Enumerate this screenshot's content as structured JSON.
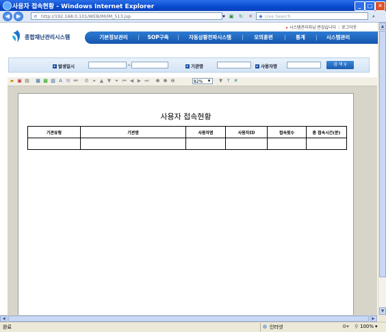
{
  "window": {
    "title": "사용자 접속현황 - Windows Internet Explorer"
  },
  "browser": {
    "url": "http://192.168.0.101/WEB/IM/IM_513.jsp",
    "search_placeholder": "Live Search"
  },
  "site": {
    "utility_links": [
      "시스템관리자님 반갑습니다",
      "로그아웃"
    ],
    "logo_text": "종합재난관리시스템",
    "nav": [
      "기본정보관리",
      "SOP구축",
      "자동상황전파시스템",
      "모의훈련",
      "통계",
      "시스템관리"
    ]
  },
  "search": {
    "labels": {
      "date": "발생일시",
      "agency": "기관명",
      "user": "사용자명"
    },
    "date_separator": "~",
    "button_label": "검 색"
  },
  "report_toolbar": {
    "zoom": "82%"
  },
  "report": {
    "title": "사용자 접속현황",
    "columns": [
      "기관유형",
      "기관명",
      "사용자명",
      "사용자ID",
      "접속횟수",
      "총 접속시간(분)"
    ],
    "rows": [
      [
        "",
        "",
        "",
        "",
        "",
        ""
      ]
    ]
  },
  "status": {
    "left": "완료",
    "zone": "인터넷",
    "zoom": "100%"
  },
  "colors": {
    "nav_blue": "#1656ad",
    "title_blue": "#0a4bd0"
  }
}
